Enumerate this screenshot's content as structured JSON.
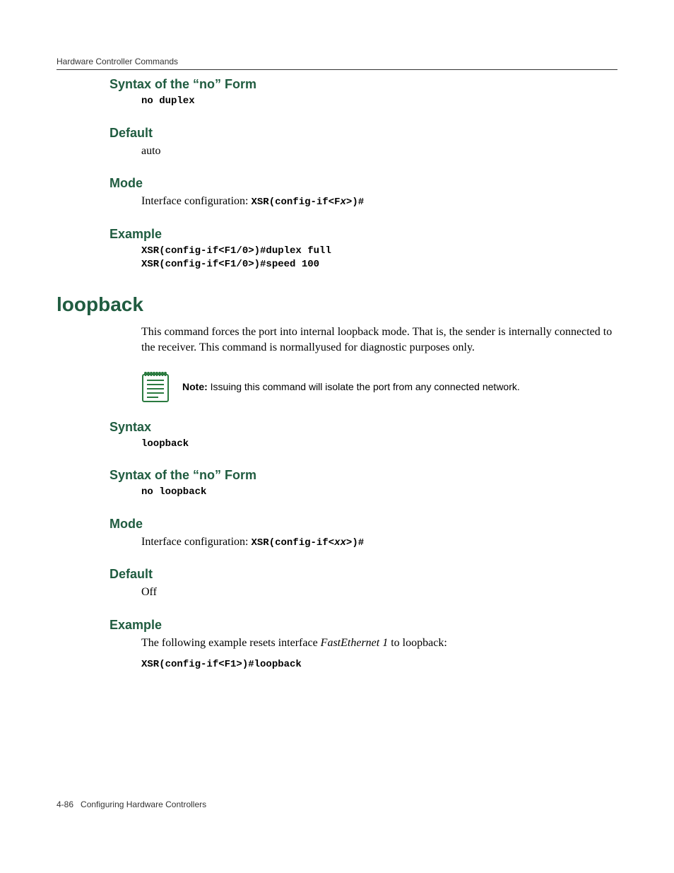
{
  "header": {
    "running_head": "Hardware Controller Commands"
  },
  "sections": {
    "s1": {
      "title": "Syntax of the “no” Form",
      "code": "no duplex"
    },
    "s2": {
      "title": "Default",
      "body": "auto"
    },
    "s3": {
      "title": "Mode",
      "body_pre": "Interface configuration: ",
      "body_code_a": "XSR(config-if<F",
      "body_code_b": "x",
      "body_code_c": ">)#"
    },
    "s4": {
      "title": "Example",
      "code": "XSR(config-if<F1/0>)#duplex full\nXSR(config-if<F1/0>)#speed 100"
    },
    "loopback": {
      "title": "loopback",
      "para": "This command forces the port into internal loopback mode. That is, the sender is internally connected to the receiver. This command is normallyused for diagnostic purposes only.",
      "note_label": "Note:",
      "note_body": " Issuing this command will isolate the port from any connected network."
    },
    "s5": {
      "title": "Syntax",
      "code": "loopback"
    },
    "s6": {
      "title": "Syntax of the “no” Form",
      "code": "no loopback"
    },
    "s7": {
      "title": "Mode",
      "body_pre": "Interface configuration: ",
      "body_code_a": "XSR(config-if<",
      "body_code_b": "xx",
      "body_code_c": ">)#"
    },
    "s8": {
      "title": "Default",
      "body": "Off"
    },
    "s9": {
      "title": "Example",
      "body_pre": "The following example resets interface ",
      "body_ital": "FastEthernet 1",
      "body_post": " to loopback:",
      "code": "XSR(config-if<F1>)#loopback"
    }
  },
  "footer": {
    "page_num": "4-86",
    "title": "Configuring Hardware Controllers"
  }
}
